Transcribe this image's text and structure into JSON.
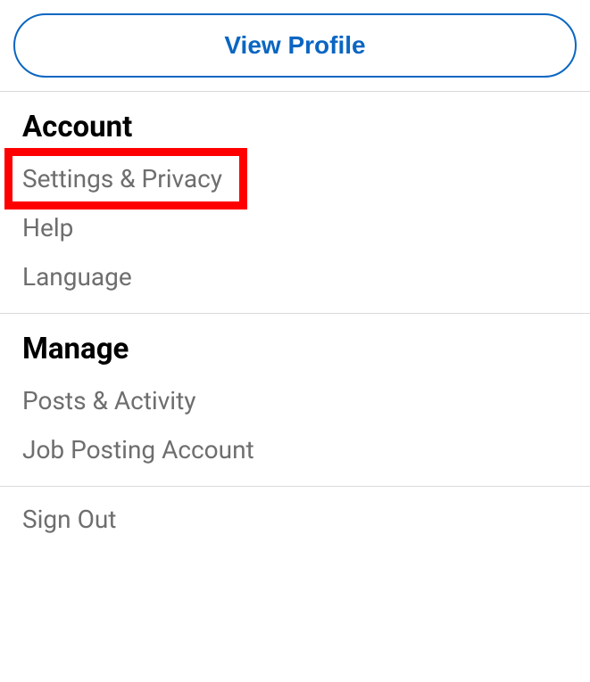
{
  "header": {
    "view_profile_label": "View Profile"
  },
  "sections": {
    "account": {
      "title": "Account",
      "items": {
        "settings_privacy": "Settings & Privacy",
        "help": "Help",
        "language": "Language"
      }
    },
    "manage": {
      "title": "Manage",
      "items": {
        "posts_activity": "Posts & Activity",
        "job_posting": "Job Posting Account"
      }
    }
  },
  "footer": {
    "sign_out": "Sign Out"
  },
  "highlight": {
    "target": "settings-privacy-item",
    "color": "#ff0000"
  }
}
